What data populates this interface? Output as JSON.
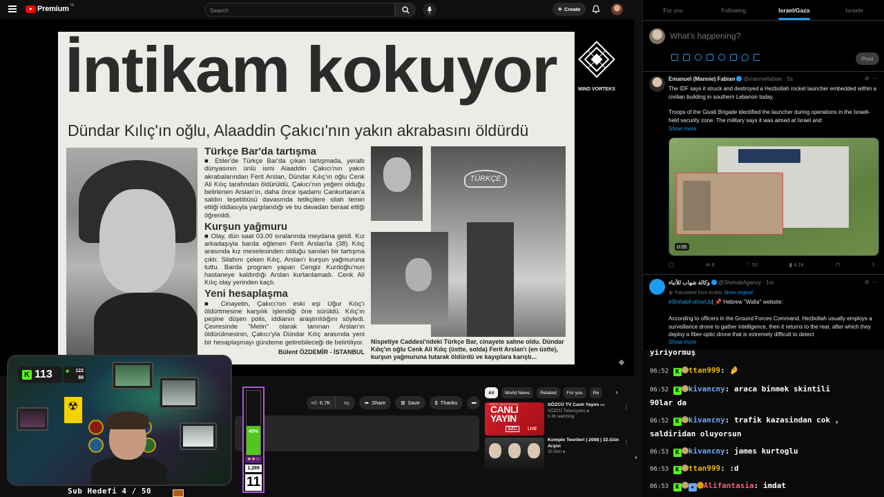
{
  "youtube": {
    "brand": "Premium",
    "brand_sup": "TR",
    "search_placeholder": "Search",
    "create_label": "Create",
    "actions": {
      "likes": "6.7K",
      "share": "Share",
      "save": "Save",
      "thanks": "Thanks"
    },
    "chips": [
      "All",
      "World News",
      "Related",
      "For you",
      "Re"
    ],
    "recommendations": [
      {
        "title": "SÖZCÜ TV Canlı Yayını",
        "hd": "HD",
        "channel": "SÖZCÜ Televizyonu",
        "meta": "5.3K watching",
        "thumb_text": "CANLI YAYIN",
        "thumb_brand": "SZC",
        "thumb_live": "LIVE",
        "thumb_top": "SÖZCÜ TELEVİZYONU"
      },
      {
        "title": "Komplo Teorileri | 2008 | 32.Gün Arşivi",
        "channel": "",
        "meta": "32.Gün"
      }
    ]
  },
  "newspaper": {
    "headline": "İntikam kokuyor",
    "subheadline": "Dündar Kılıç'ın oğlu, Alaaddin Çakıcı'nın yakın akrabasını öldürdü",
    "sections": [
      {
        "title": "Türkçe Bar'da tartışma",
        "body": "■ Etiler'de Türkçe Bar'da çıkan tartışmada, yeraltı dünyasının ünlü ismi Alaaddin Çakıcı'nın yakın akrabalarından Ferit Arslan, Dündar Kılıç'ın oğlu Cenk Ali Kılıç tarafından öldürüldü. Çakıcı'nın yeğeni olduğu belirlenen Arslan'ın, daha önce işadamı Cankurtaran'a saldırı teşebbüsü davasında tetikçilere silah temin ettiği iddiasıyla yargılandığı ve bu davadan beraat ettiği öğrenildi."
      },
      {
        "title": "Kurşun yağmuru",
        "body": "■ Olay, dün saat 03.00 sıralarında meydana geldi. Kız arkadaşıyla barda eğlenen Ferit Arslan'la (38) Kılıç arasında kız meselesinden olduğu sanılan bir tartışma çıktı. Silahını çeken Kılıç, Arslan'ı kurşun yağmuruna tuttu. Barda program yapan Cengiz Kurdoğlu'nun hastaneye kaldırdığı Arslan kurtarılamadı. Cenk Ali Kılıç olay yerinden kaçtı."
      },
      {
        "title": "Yeni hesaplaşma",
        "body": "■ Cinayetin, Çakıcı'nın eski eşi Uğur Kılıç'ı öldürtmesine karşılık işlendiği öne sürüldü. Kılıç'ın peşine düşen polis, iddianın araştırıldığını söyledi. Çevresinde \"Metin\" olarak tanınan Arslan'ın öldürülmesinin, Çakıcı'yla Dündar Kılıç arasında yeni bir hesaplaşmayı gündeme getirebileceği de belirtiliyor."
      }
    ],
    "byline": "Bülent ÖZDEMİR - İSTANBUL",
    "bar_sign": "TÜRKÇE",
    "caption": "Nispetiye Caddesi'ndeki Türkçe Bar, cinayete sahne oldu. Dündar Kılıç'ın oğlu Cenk Ali Kılıç (üstte, solda) Ferit Arslan'ı (en üstte), kurşun yağmuruna tutarak öldürdü ve kayıplara karıştı..."
  },
  "overlay": {
    "watermark": "MIND VORTEKS",
    "kick_count": "113",
    "kick_stat_a": "122",
    "kick_stat_b": "88",
    "sub_goal": "Sub Hedefi 4 / 50",
    "goal": {
      "percent": 45,
      "percent_label": "45%",
      "stars": "★★☆",
      "count": "1,289",
      "level": "11"
    }
  },
  "x": {
    "tabs": [
      "For you",
      "Following",
      "Israel/Gaza",
      "Israele"
    ],
    "active_tab": 2,
    "compose_placeholder": "What's happening?",
    "post_label": "Post",
    "tweets": [
      {
        "name": "Emanuel (Mannie) Fabian",
        "handle": "@manniefabian · 5s",
        "text1": "The IDF says it struck and destroyed a Hezbollah rocket launcher embedded within a civilian building in southern Lebanon today.",
        "text2": "Troops of the Givati Brigade identified the launcher during operations in the Israeli-held security zone. The military says it was aimed at Israel and",
        "show_more": "Show more",
        "video_duration": "0:05",
        "retweets": "8",
        "likes": "52",
        "views": "4.1K"
      },
      {
        "name": "وكالة شهاب للأنباء",
        "handle": "@ShehabAgency · 1m",
        "translated": "Translated from Arabic",
        "show_original": "Show original",
        "hashtag": "#ShihabFollowUp",
        "text_head": "📌 Hebrew \"Walla\" website:",
        "text_body": "According to officers in the Ground Forces Command, Hezbollah usually employs a surveillance drone to gather intelligence, then it returns to the rear, after which they deploy a fiber-optic drone that is extremely difficult to detect",
        "show_more": "Show more"
      }
    ]
  },
  "chat": {
    "partial": "yiriyormuş",
    "messages": [
      {
        "time": "06:52",
        "user": "ttan999",
        "text": "🤌",
        "color": "ttan"
      },
      {
        "time": "06:52",
        "user": "kivancny",
        "text": "araca binmek skintili",
        "color": "kiv"
      },
      {
        "time": "",
        "user": "",
        "text": "90lar da",
        "color": ""
      },
      {
        "time": "06:52",
        "user": "kivancny",
        "text": "trafik kazasindan cok ,",
        "color": "kiv"
      },
      {
        "time": "",
        "user": "",
        "text": "saldiridan oluyorsun",
        "color": ""
      },
      {
        "time": "06:53",
        "user": "kivancny",
        "text": "james kurtoglu",
        "color": "kiv"
      },
      {
        "time": "06:53",
        "user": "ttan999",
        "text": ":d",
        "color": "ttan"
      },
      {
        "time": "06:53",
        "user": "Alifantasia",
        "text": "imdat",
        "color": "ali"
      }
    ],
    "colors": {
      "ttan": "#e6b800",
      "kiv": "#6ea8ff",
      "ali": "#ff5b7f",
      "kick": "#53fc18"
    }
  }
}
